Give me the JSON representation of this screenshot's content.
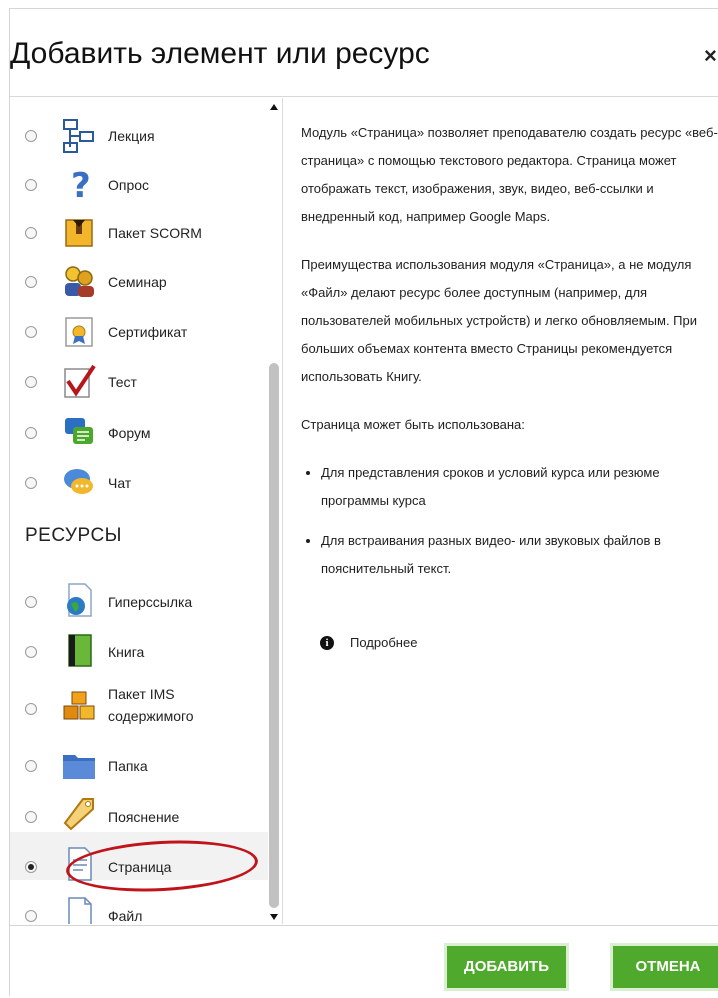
{
  "dialog": {
    "title": "Добавить элемент или ресурс",
    "close_glyph": "×"
  },
  "activities": [
    {
      "label": "Лекция",
      "icon": "lesson-icon"
    },
    {
      "label": "Опрос",
      "icon": "question-icon"
    },
    {
      "label": "Пакет SCORM",
      "icon": "scorm-package-icon"
    },
    {
      "label": "Семинар",
      "icon": "workshop-icon"
    },
    {
      "label": "Сертификат",
      "icon": "certificate-icon"
    },
    {
      "label": "Тест",
      "icon": "quiz-check-icon"
    },
    {
      "label": "Форум",
      "icon": "forum-icon"
    },
    {
      "label": "Чат",
      "icon": "chat-icon"
    }
  ],
  "resources_heading": "РЕСУРСЫ",
  "resources": [
    {
      "label": "Гиперссылка",
      "icon": "url-icon",
      "selected": false
    },
    {
      "label": "Книга",
      "icon": "book-icon",
      "selected": false
    },
    {
      "label": "Пакет IMS",
      "label2": "содержимого",
      "icon": "ims-package-icon",
      "selected": false
    },
    {
      "label": "Папка",
      "icon": "folder-icon",
      "selected": false
    },
    {
      "label": "Пояснение",
      "icon": "label-tag-icon",
      "selected": false
    },
    {
      "label": "Страница",
      "icon": "page-icon",
      "selected": true
    },
    {
      "label": "Файл",
      "icon": "file-icon",
      "selected": false
    }
  ],
  "description": {
    "para1": "Модуль «Страница» позволяет преподавателю создать ресурс «веб-страница» с помощью текстового редактора. Страница может отображать текст, изображения, звук, видео, веб-ссылки и внедренный код, например Google Maps.",
    "para2": "Преимущества использования модуля «Страница», а не модуля «Файл» делают ресурс более доступным (например, для пользователей мобильных устройств) и легко обновляемым. При больших объемах контента вместо Страницы рекомендуется использовать Книгу.",
    "para3": "Страница может быть использована:",
    "bullets": [
      "Для представления сроков и условий курса или резюме программы курса",
      "Для встраивания разных видео- или звуковых файлов в пояснительный текст."
    ],
    "more_link": "Подробнее",
    "info_glyph": "i"
  },
  "footer": {
    "add_label": "ДОБАВИТЬ",
    "cancel_label": "ОТМЕНА"
  },
  "colors": {
    "button_green": "#4ea92c",
    "highlight_circle": "#c0141b"
  }
}
